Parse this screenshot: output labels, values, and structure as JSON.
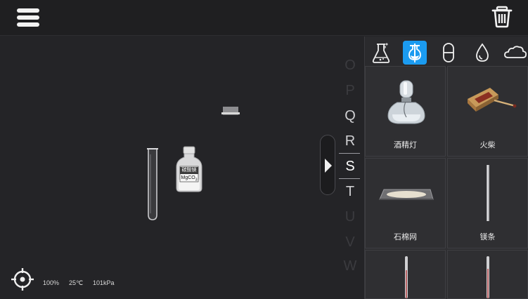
{
  "toolbar": {
    "menu_icon": "hamburger-menu-icon",
    "trash_icon": "trash-icon"
  },
  "workspace": {
    "bottle_label_line1": "碳酸镁",
    "bottle_label_line2": "MgCO",
    "bottle_label_sub": "3"
  },
  "alphabet": {
    "letters": [
      "O",
      "P",
      "Q",
      "R",
      "S",
      "T",
      "U",
      "V",
      "W"
    ],
    "active": "S"
  },
  "status": {
    "locate_icon": "crosshair-icon",
    "zoom": "100%",
    "temperature": "25℃",
    "pressure": "101kPa"
  },
  "categories": [
    {
      "icon": "flask-icon",
      "selected": false
    },
    {
      "icon": "dropper-icon",
      "selected": true
    },
    {
      "icon": "capsule-icon",
      "selected": false
    },
    {
      "icon": "droplet-icon",
      "selected": false
    },
    {
      "icon": "cloud-icon",
      "selected": false
    }
  ],
  "items": [
    {
      "label": "酒精灯",
      "icon": "alcohol-lamp-icon"
    },
    {
      "label": "火柴",
      "icon": "matches-icon"
    },
    {
      "label": "石棉网",
      "icon": "asbestos-gauze-icon"
    },
    {
      "label": "镁条",
      "icon": "magnesium-strip-icon"
    },
    {
      "label": "",
      "icon": "thermometer-icon"
    },
    {
      "label": "",
      "icon": "thermometer-icon"
    }
  ]
}
